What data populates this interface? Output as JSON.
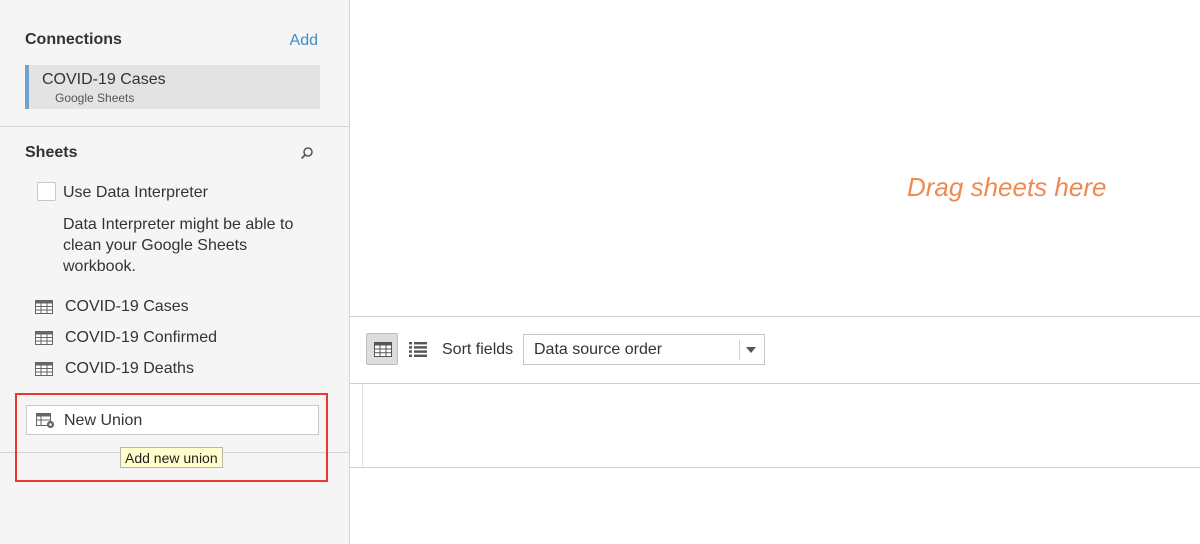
{
  "connections": {
    "title": "Connections",
    "add_label": "Add",
    "item": {
      "name": "COVID-19 Cases",
      "type": "Google Sheets"
    }
  },
  "sheets": {
    "title": "Sheets",
    "search_icon": "search-icon",
    "interpreter": {
      "checked": false,
      "label": "Use Data Interpreter",
      "description": "Data Interpreter might be able to clean your Google Sheets workbook."
    },
    "items": [
      {
        "label": "COVID-19 Cases",
        "icon": "sheet-table-icon"
      },
      {
        "label": "COVID-19 Confirmed",
        "icon": "sheet-table-icon"
      },
      {
        "label": "COVID-19 Deaths",
        "icon": "sheet-table-icon"
      }
    ],
    "new_union": {
      "label": "New Union",
      "icon": "union-icon",
      "tooltip": "Add new union"
    }
  },
  "canvas": {
    "drag_hint": "Drag sheets here"
  },
  "toolbar": {
    "grid_view_icon": "grid-view-icon",
    "list_view_icon": "list-view-icon",
    "sort_label": "Sort fields",
    "sort_value": "Data source order"
  },
  "colors": {
    "accent_link": "#3d8ec4",
    "drag_hint": "#ee8a4f",
    "highlight": "#e8382f",
    "tooltip_bg": "#ffffcc",
    "connection_bar": "#6ea3cf"
  }
}
